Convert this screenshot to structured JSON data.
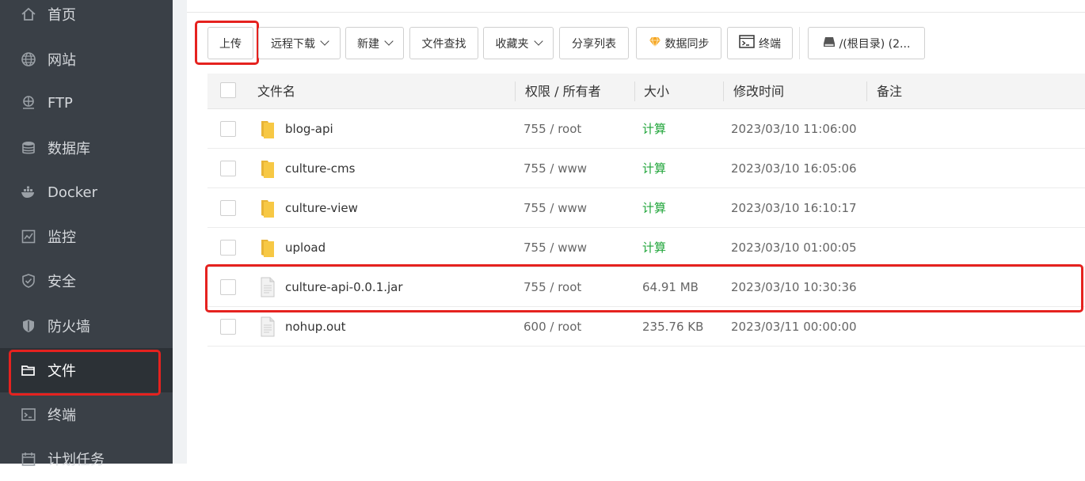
{
  "sidebar": {
    "items": [
      {
        "label": "首页",
        "icon": "home-icon"
      },
      {
        "label": "网站",
        "icon": "globe-icon"
      },
      {
        "label": "FTP",
        "icon": "ftp-icon"
      },
      {
        "label": "数据库",
        "icon": "database-icon"
      },
      {
        "label": "Docker",
        "icon": "docker-icon"
      },
      {
        "label": "监控",
        "icon": "monitor-icon"
      },
      {
        "label": "安全",
        "icon": "shield-check-icon"
      },
      {
        "label": "防火墙",
        "icon": "firewall-icon"
      },
      {
        "label": "文件",
        "icon": "folder-icon"
      },
      {
        "label": "终端",
        "icon": "terminal-icon"
      },
      {
        "label": "计划任务",
        "icon": "calendar-icon"
      }
    ],
    "active": "文件"
  },
  "toolbar": {
    "upload": "上传",
    "remote_download": "远程下载",
    "new": "新建",
    "file_search": "文件查找",
    "favorites": "收藏夹",
    "share_list": "分享列表",
    "data_sync": "数据同步",
    "terminal": "终端",
    "path": "/(根目录) (2..."
  },
  "table": {
    "headers": {
      "name": "文件名",
      "perm": "权限 / 所有者",
      "size": "大小",
      "mtime": "修改时间",
      "note": "备注"
    },
    "rows": [
      {
        "type": "folder",
        "name": "blog-api",
        "perm": "755 / root",
        "size": "计算",
        "mtime": "2023/03/10 11:06:00"
      },
      {
        "type": "folder",
        "name": "culture-cms",
        "perm": "755 / www",
        "size": "计算",
        "mtime": "2023/03/10 16:05:06"
      },
      {
        "type": "folder",
        "name": "culture-view",
        "perm": "755 / www",
        "size": "计算",
        "mtime": "2023/03/10 16:10:17"
      },
      {
        "type": "folder",
        "name": "upload",
        "perm": "755 / www",
        "size": "计算",
        "mtime": "2023/03/10 01:00:05"
      },
      {
        "type": "file",
        "name": "culture-api-0.0.1.jar",
        "perm": "755 / root",
        "size": "64.91 MB",
        "mtime": "2023/03/10 10:30:36"
      },
      {
        "type": "file",
        "name": "nohup.out",
        "perm": "600 / root",
        "size": "235.76 KB",
        "mtime": "2023/03/11 00:00:00"
      }
    ]
  },
  "colors": {
    "sidebar_bg": "#3a4047",
    "sidebar_active_bg": "#2c3136",
    "highlight": "#e5221f",
    "calc_green": "#20a53a",
    "folder_yellow": "#f7c844",
    "gem_orange": "#f5a623"
  }
}
